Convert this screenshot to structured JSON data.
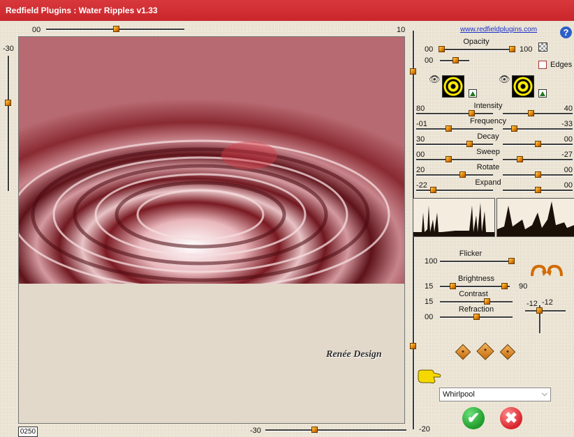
{
  "window": {
    "title": "Redfield Plugins : Water Ripples v1.33"
  },
  "top_slider": {
    "min_label": "00",
    "max_label": "10"
  },
  "left_slider": {
    "label": "-30"
  },
  "bottom": {
    "frame_label": "0250",
    "slider_label": "-30",
    "right_label": "-20"
  },
  "website": "www.redfieldplugins.com",
  "help_icon": "?",
  "watermark": "Renée Design",
  "opacity": {
    "title": "Opacity",
    "left": "00",
    "right": "100",
    "second_left": "00"
  },
  "edges": {
    "label": "Edges",
    "checked": false
  },
  "params": [
    {
      "name": "Intensity",
      "left": "80",
      "right": "40"
    },
    {
      "name": "Frequency",
      "left": "-01",
      "right": "-33"
    },
    {
      "name": "Decay",
      "left": "30",
      "right": "00"
    },
    {
      "name": "Sweep",
      "left": "00",
      "right": "-27"
    },
    {
      "name": "Rotate",
      "left": "20",
      "right": "00"
    },
    {
      "name": "Expand",
      "left": "-22",
      "right": "00"
    }
  ],
  "lighting": {
    "flicker": {
      "label": "Flicker",
      "value": "100"
    },
    "brightness": {
      "label": "Brightness",
      "value": "15",
      "right": "90"
    },
    "contrast": {
      "label": "Contrast",
      "value": "15"
    },
    "refraction": {
      "label": "Refraction",
      "value": "00"
    },
    "light_x": "-12",
    "light_y": "-12"
  },
  "preset": {
    "selected": "Whirlpool"
  },
  "icons": {
    "help": "help-icon",
    "eye": "eye-icon",
    "pattern": "pattern-swatch-icon",
    "arrows": "rotate-arrows-icon",
    "dice": "dice-icon",
    "hand": "pointing-hand-icon",
    "ok": "checkmark-icon",
    "cancel": "cross-icon"
  },
  "colors": {
    "titlebar": "#c9262b",
    "accent": "#e08000",
    "ok": "#1f9b2a",
    "cancel": "#d8242a"
  }
}
